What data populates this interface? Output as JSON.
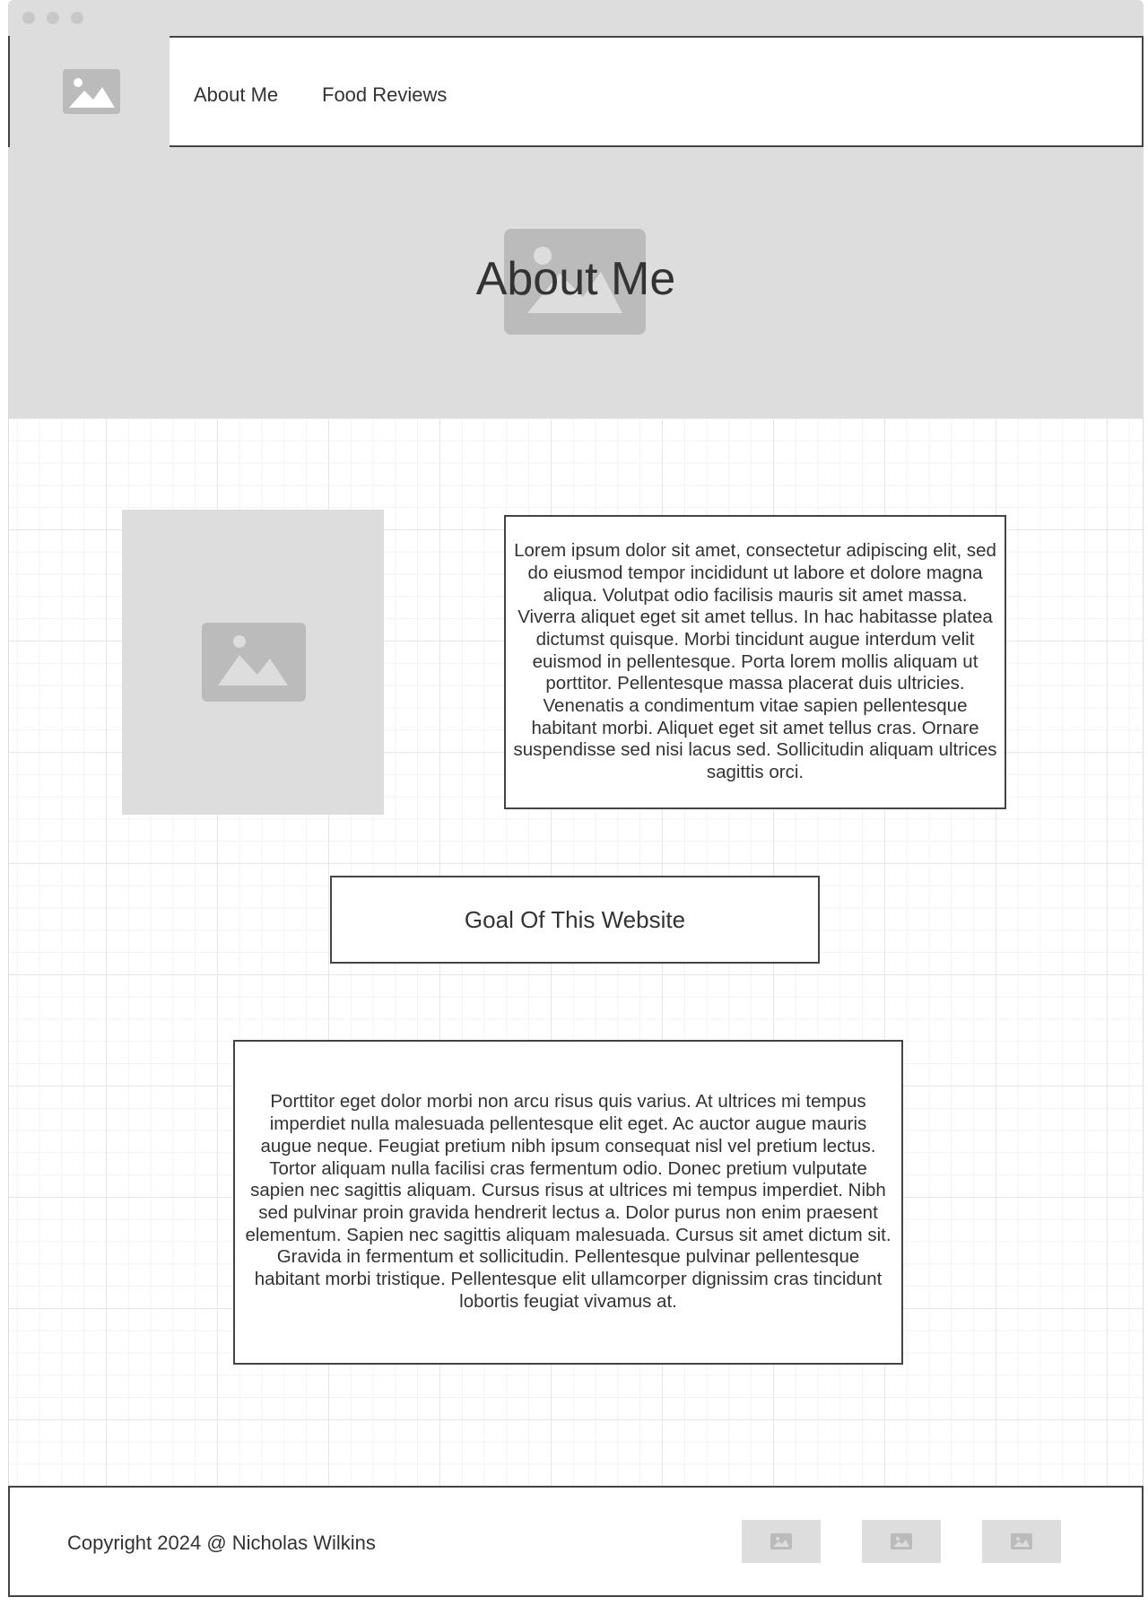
{
  "header": {
    "logo_icon": "image-placeholder-icon",
    "nav": [
      {
        "label": "About Me"
      },
      {
        "label": "Food Reviews"
      }
    ]
  },
  "hero": {
    "title": "About Me",
    "background_icon": "image-placeholder-icon"
  },
  "about": {
    "photo_icon": "image-placeholder-icon",
    "bio": "Lorem ipsum dolor sit amet, consectetur adipiscing elit, sed do eiusmod tempor incididunt ut labore et dolore magna aliqua. Volutpat odio facilisis mauris sit amet massa. Viverra aliquet eget sit amet tellus. In hac habitasse platea dictumst quisque. Morbi tincidunt augue interdum velit euismod in pellentesque. Porta lorem mollis aliquam ut porttitor. Pellentesque massa placerat duis ultricies. Venenatis a condimentum vitae sapien pellentesque habitant morbi. Aliquet eget sit amet tellus cras. Ornare suspendisse sed nisi lacus sed. Sollicitudin aliquam ultrices sagittis orci."
  },
  "goal": {
    "heading": "Goal Of This Website",
    "text": "Porttitor eget dolor morbi non arcu risus quis varius. At ultrices mi tempus imperdiet nulla malesuada pellentesque elit eget. Ac auctor augue mauris augue neque. Feugiat pretium nibh ipsum consequat nisl vel pretium lectus. Tortor aliquam nulla facilisi cras fermentum odio. Donec pretium vulputate sapien nec sagittis aliquam. Cursus risus at ultrices mi tempus imperdiet. Nibh sed pulvinar proin gravida hendrerit lectus a. Dolor purus non enim praesent elementum. Sapien nec sagittis aliquam malesuada. Cursus sit amet dictum sit. Gravida in fermentum et sollicitudin. Pellentesque pulvinar pellentesque habitant morbi tristique. Pellentesque elit ullamcorper dignissim cras tincidunt lobortis feugiat vivamus at."
  },
  "footer": {
    "copyright": "Copyright 2024 @ Nicholas Wilkins",
    "social_icons": [
      "image-placeholder-icon",
      "image-placeholder-icon",
      "image-placeholder-icon"
    ]
  },
  "colors": {
    "placeholder_bg": "#dddddd",
    "placeholder_icon": "#bbbbbb",
    "border": "#444444",
    "text": "#333333"
  }
}
